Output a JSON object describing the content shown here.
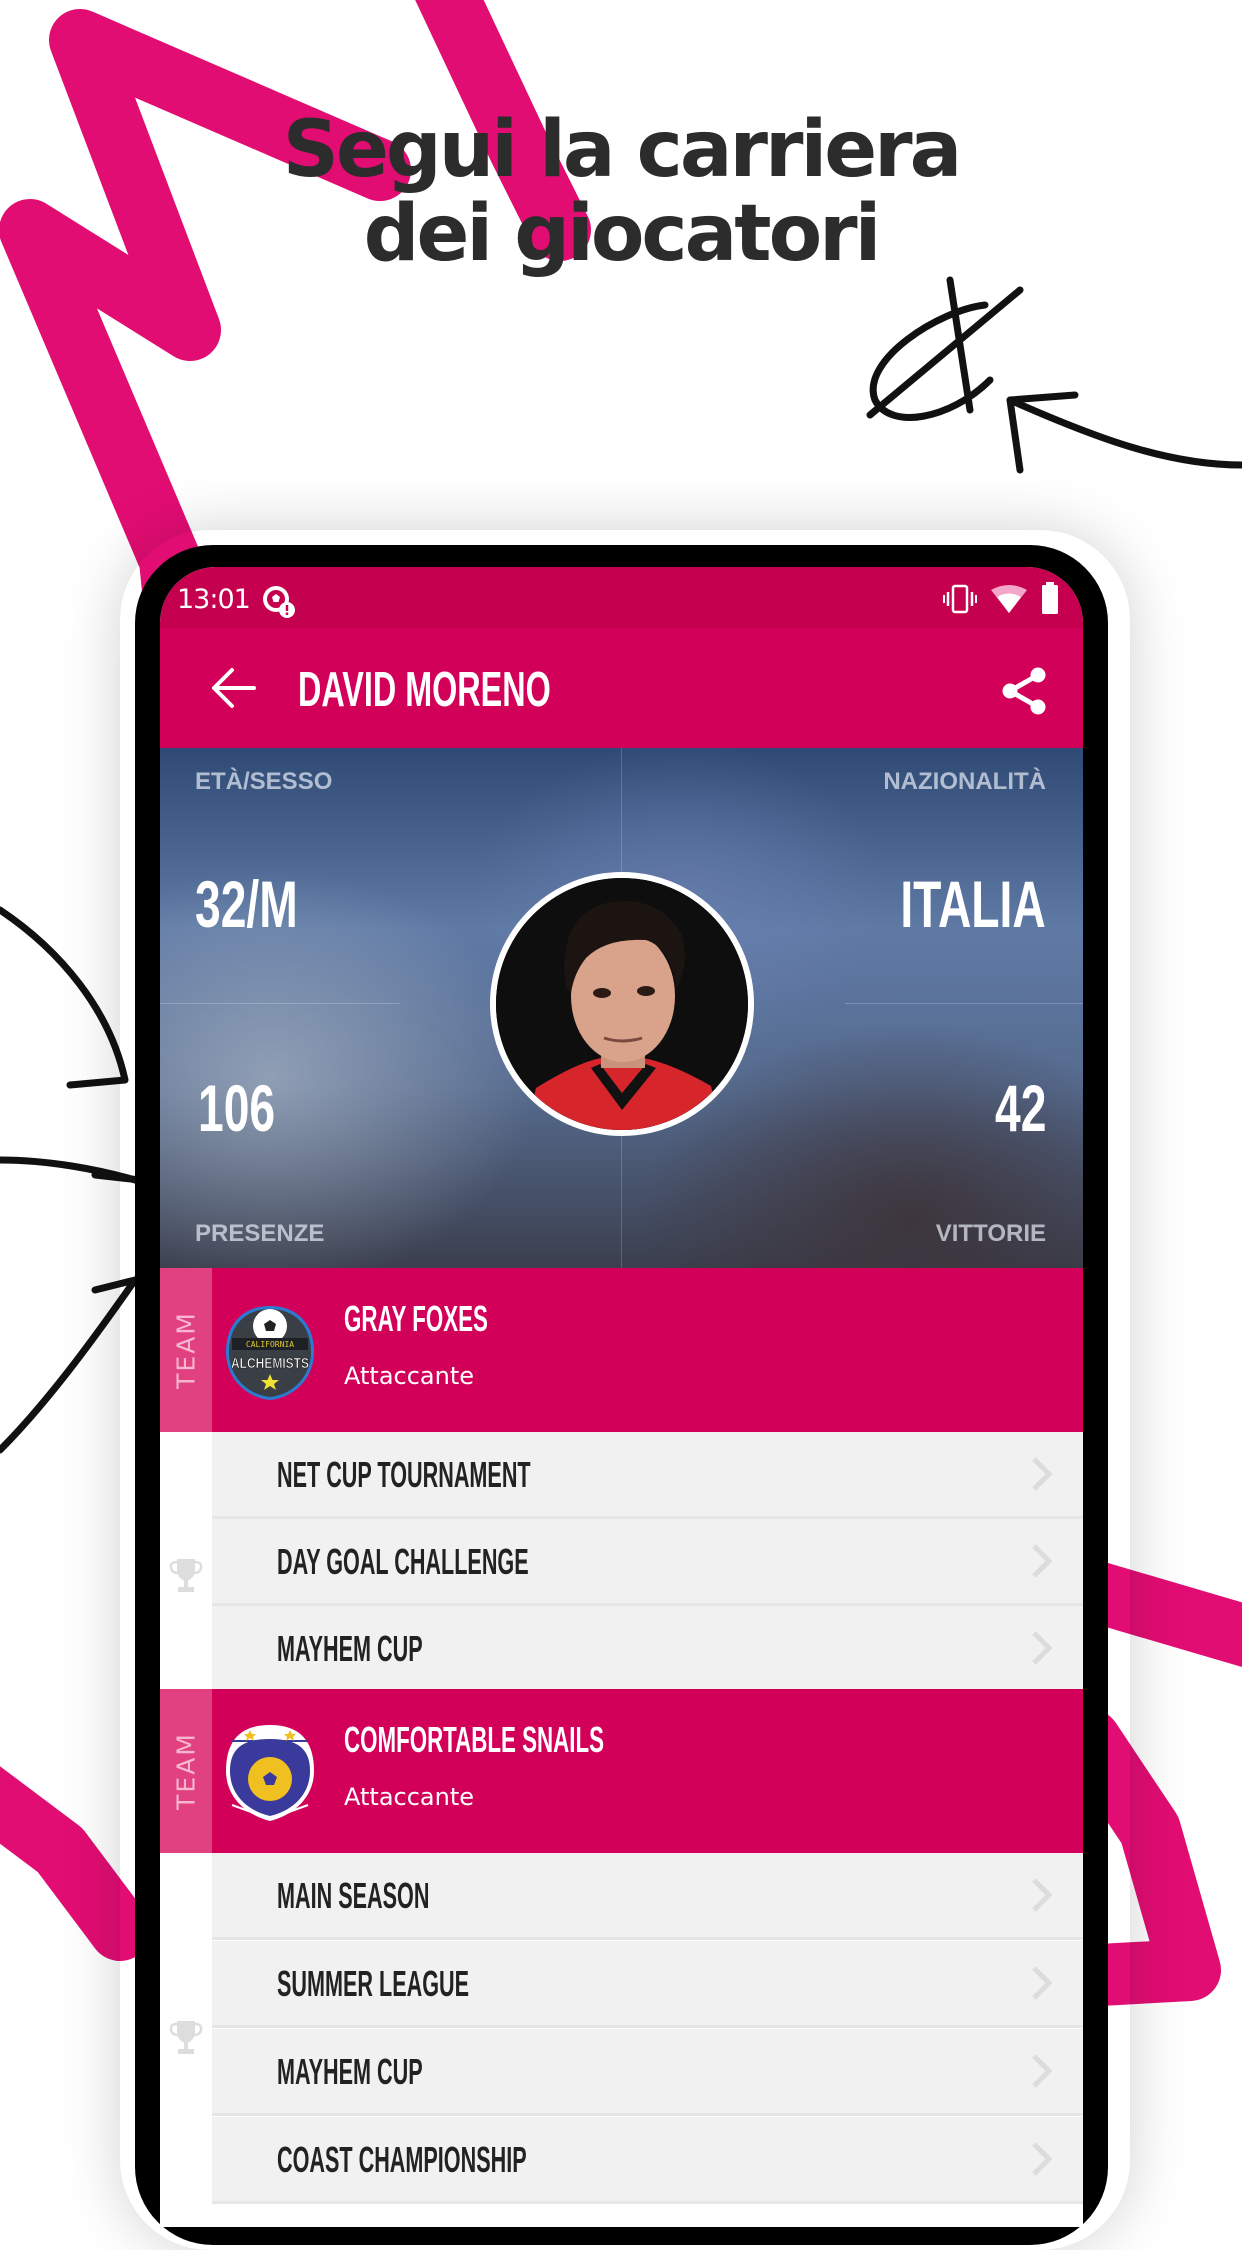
{
  "promo": {
    "headline_line1": "Segui la carriera",
    "headline_line2": "dei giocatori",
    "accent_color": "#e0006b"
  },
  "status_bar": {
    "time": "13:01",
    "icons": [
      "soccer-notification-icon",
      "vibrate-icon",
      "wifi-icon",
      "battery-icon"
    ]
  },
  "app_bar": {
    "back_icon": "arrow-left-icon",
    "title": "DAVID MORENO",
    "share_icon": "share-icon",
    "color": "#d3005a"
  },
  "player_stats": {
    "age_sex": {
      "label": "ETÀ/SESSO",
      "value": "32/M"
    },
    "nationality": {
      "label": "NAZIONALITÀ",
      "value": "ITALIA"
    },
    "appearances": {
      "label": "PRESENZE",
      "value": "106"
    },
    "wins": {
      "label": "VITTORIE",
      "value": "42"
    }
  },
  "teams": [
    {
      "strip_label": "TEAM",
      "name": "GRAY FOXES",
      "role": "Attaccante",
      "logo_text_top": "CALIFORNIA",
      "logo_text_main": "ALCHEMISTS",
      "competitions": [
        {
          "label": "NET CUP TOURNAMENT"
        },
        {
          "label": "DAY GOAL CHALLENGE"
        },
        {
          "label": "MAYHEM CUP"
        }
      ]
    },
    {
      "strip_label": "TEAM",
      "name": "COMFORTABLE SNAILS",
      "role": "Attaccante",
      "competitions": [
        {
          "label": "MAIN SEASON"
        },
        {
          "label": "SUMMER LEAGUE"
        },
        {
          "label": "MAYHEM CUP"
        },
        {
          "label": "COAST CHAMPIONSHIP"
        }
      ]
    }
  ]
}
